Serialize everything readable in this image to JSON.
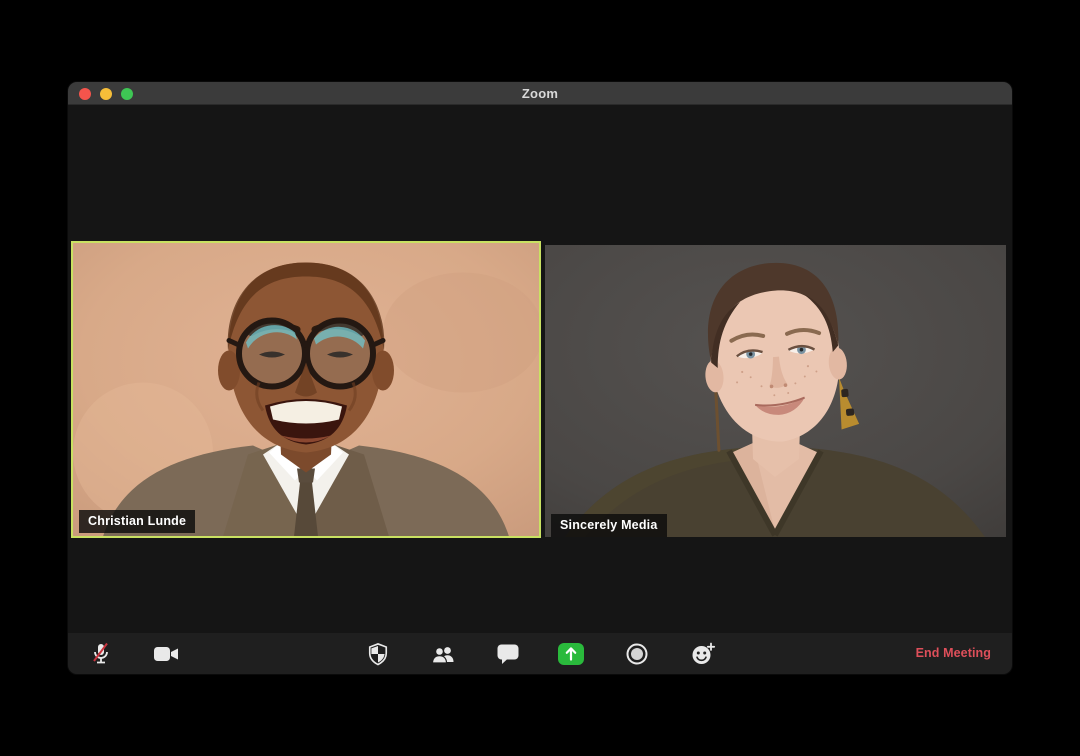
{
  "window": {
    "title": "Zoom"
  },
  "participants": [
    {
      "name": "Christian Lunde",
      "active": true,
      "border_color": "#c9e162"
    },
    {
      "name": "Sincerely Media",
      "active": false,
      "border_color": "none"
    }
  ],
  "toolbar": {
    "icons": [
      "microphone-muted-icon",
      "video-camera-icon",
      "security-shield-icon",
      "participants-icon",
      "chat-icon",
      "share-screen-icon",
      "record-icon",
      "reactions-icon"
    ],
    "end_meeting_label": "End Meeting"
  },
  "colors": {
    "titlebar": "#3b3b3b",
    "window_background": "#151515",
    "toolbar_background": "#1f1f1f",
    "active_speaker_border": "#c9e162",
    "share_screen_green": "#2aba3c",
    "end_meeting_red": "#de4f5a",
    "mic_slash_red": "#c9353f",
    "traffic_close": "#f4544c",
    "traffic_minimize": "#f6be39",
    "traffic_zoom": "#3ec654"
  }
}
